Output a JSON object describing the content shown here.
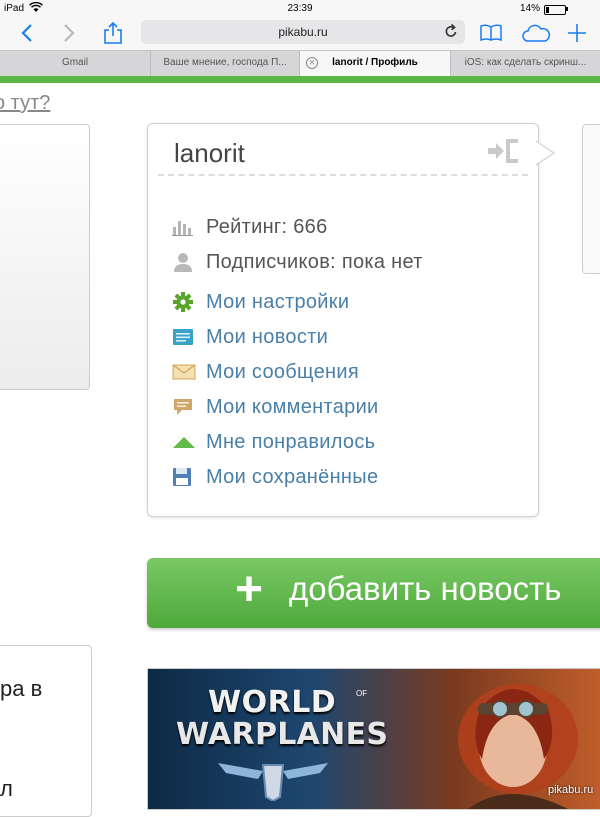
{
  "status_bar": {
    "device": "iPad",
    "time": "23:39",
    "battery": "14%",
    "battery_level": 0.14
  },
  "toolbar": {
    "url": "pikabu.ru"
  },
  "tabs": [
    {
      "label": "Gmail"
    },
    {
      "label": "Ваше мнение, господа П..."
    },
    {
      "label": "lanorit / Профиль"
    },
    {
      "label": "iOS: как сделать скринш..."
    }
  ],
  "page": {
    "help_link": "о тут?",
    "profile": {
      "username": "lanorit",
      "rating": "Рейтинг: 666",
      "subscribers": "Подписчиков: пока нет",
      "links": [
        {
          "label": "Мои настройки",
          "icon": "gear-icon"
        },
        {
          "label": "Мои новости",
          "icon": "news-icon"
        },
        {
          "label": "Мои сообщения",
          "icon": "envelope-icon"
        },
        {
          "label": "Мои комментарии",
          "icon": "comment-icon"
        },
        {
          "label": "Мне понравилось",
          "icon": "upvote-icon"
        },
        {
          "label": "Мои сохранённые",
          "icon": "floppy-icon"
        }
      ]
    },
    "add_news": {
      "plus": "+",
      "label": "добавить новость"
    },
    "left_text_1": "ра в",
    "left_text_2": "л",
    "ad": {
      "world": "WORLD",
      "of": "OF",
      "planes": "WARPLANES"
    },
    "watermark": "pikabu.ru"
  },
  "colors": {
    "accent_green": "#5cb845",
    "link_blue": "#4a7fa8",
    "button_green": "#4ea93a"
  }
}
